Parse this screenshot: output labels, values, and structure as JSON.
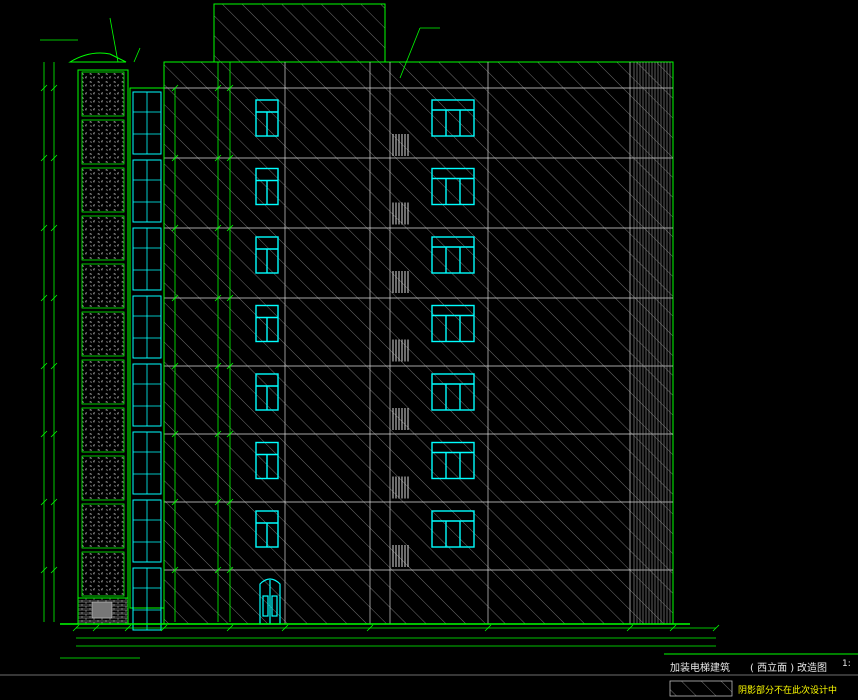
{
  "title_block": {
    "title": "加装电梯建筑",
    "elevation": "( 西立面 )",
    "view": "改造图",
    "scale": "1:"
  },
  "legend": {
    "text": "阴影部分不在此次设计中"
  },
  "colors": {
    "background": "#000000",
    "outline": "#00ff00",
    "hatch": "#bcbcbc",
    "window": "#00ffff",
    "text": "#ffffff",
    "legend_text": "#ffff00",
    "brick": "#c8c8c8"
  }
}
